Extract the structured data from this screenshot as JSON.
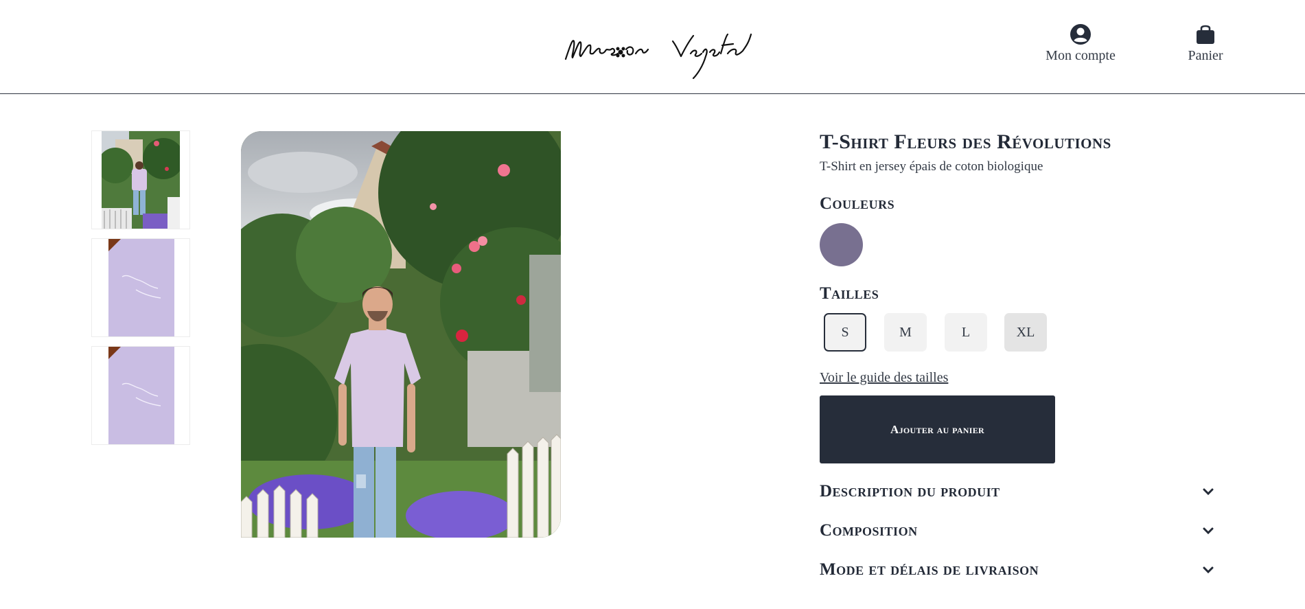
{
  "header": {
    "brand": "Maison Vepeta",
    "account_label": "Mon compte",
    "cart_label": "Panier"
  },
  "gallery": {
    "thumbnails": [
      "photo-back-view",
      "print-closeup",
      "print-closeup"
    ]
  },
  "product": {
    "title": "T-Shirt Fleurs des Révolutions",
    "subtitle": "T-Shirt en jersey épais de coton biologique",
    "colors_heading": "Couleurs",
    "colors": [
      {
        "hex": "#787090"
      }
    ],
    "sizes_heading": "Tailles",
    "sizes": [
      "S",
      "M",
      "L",
      "XL"
    ],
    "selected_size": "S",
    "size_guide_link": "Voir le guide des tailles",
    "add_to_cart": "Ajouter au panier"
  },
  "accordions": [
    {
      "label": "Description du produit"
    },
    {
      "label": "Composition"
    },
    {
      "label": "Mode et délais de livraison"
    }
  ],
  "colors": {
    "primary": "#262d3a",
    "size_bg": "#f2f2f2",
    "tshirt": "#d6c8e2"
  }
}
